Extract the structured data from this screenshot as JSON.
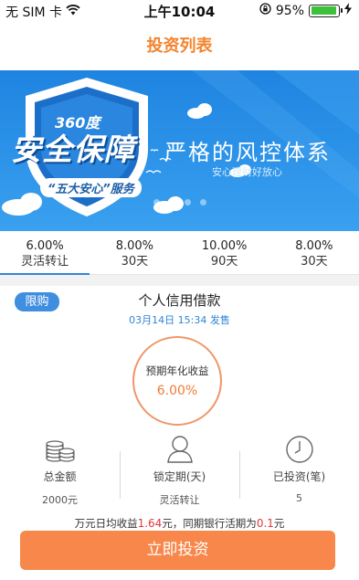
{
  "status_bar": {
    "carrier": "无 SIM 卡",
    "time": "上午10:04",
    "battery_percent": "95%",
    "battery_level": 0.95,
    "icons": [
      "wifi-icon",
      "rotation-lock-icon",
      "battery-icon",
      "charging-icon"
    ]
  },
  "nav": {
    "title": "投资列表"
  },
  "banner": {
    "badge_360": "360度",
    "main_title": "安全保障",
    "tag": "“五大安心”服务",
    "slogan": "严格的风控体系",
    "subslogan": "安心理财好放心",
    "page_count": 4,
    "active_page": 2
  },
  "tabs": [
    {
      "rate": "6.00%",
      "term": "灵活转让",
      "active": true
    },
    {
      "rate": "8.00%",
      "term": "30天",
      "active": false
    },
    {
      "rate": "10.00%",
      "term": "90天",
      "active": false
    },
    {
      "rate": "8.00%",
      "term": "30天",
      "active": false
    }
  ],
  "product": {
    "badge": "限购",
    "title": "个人信用借款",
    "sale_time": "03月14日 15:34 发售",
    "yield_label": "预期年化收益",
    "yield_value": "6.00%"
  },
  "stats": [
    {
      "icon": "coins-icon",
      "label": "总金额",
      "value": "2000元"
    },
    {
      "icon": "person-icon",
      "label": "锁定期(天)",
      "value": "灵活转让"
    },
    {
      "icon": "clock-icon",
      "label": "已投资(笔)",
      "value": "5"
    }
  ],
  "compare": {
    "prefix": "万元日均收益",
    "daily_income": "1.64",
    "middle": "元，同期银行活期为",
    "bank_rate": "0.1",
    "suffix": "元"
  },
  "action": {
    "invest_label": "立即投资"
  },
  "colors": {
    "accent_orange": "#f4832b",
    "button_orange": "#f7874a",
    "blue": "#2f86d7",
    "red": "#e0393b",
    "banner_blue": "#1f84e0"
  }
}
